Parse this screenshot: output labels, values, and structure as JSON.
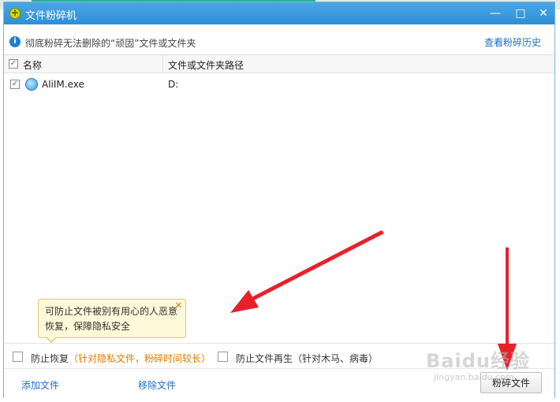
{
  "window": {
    "title": "文件粉碎机",
    "minimize_glyph": "—",
    "maximize_glyph": "□",
    "close_glyph": "✕"
  },
  "info": {
    "icon": "info-icon",
    "text": "彻底粉碎无法删除的“顽固”文件或文件夹",
    "history_link": "查看粉碎历史"
  },
  "table": {
    "columns": [
      "名称",
      "文件或文件夹路径"
    ],
    "header_checked": true,
    "rows": [
      {
        "checked": true,
        "name": "AliIM.exe",
        "path": "D:"
      }
    ]
  },
  "tooltip": {
    "line1": "可防止文件被别有用心的人恶意",
    "line2": "恢复，保障隐私安全",
    "close_glyph": "✕"
  },
  "options": {
    "prevent_recovery": {
      "checked": false,
      "label": "防止恢复",
      "hint": "（针对隐私文件，粉碎时间较长）"
    },
    "prevent_regen": {
      "checked": false,
      "label": "防止文件再生",
      "hint": "（针对木马、病毒）"
    }
  },
  "footer": {
    "add_file": "添加文件",
    "remove_file": "移除文件",
    "shred_button": "粉碎文件"
  },
  "watermark": {
    "main": "Baidu经验",
    "sub": "jingyan.baidu.com"
  },
  "colors": {
    "titlebar": "#3d9be0",
    "link": "#1a6fc7",
    "hint_orange": "#e07b00",
    "arrow_red": "#e8202a",
    "tooltip_bg": "#fff8d9"
  }
}
